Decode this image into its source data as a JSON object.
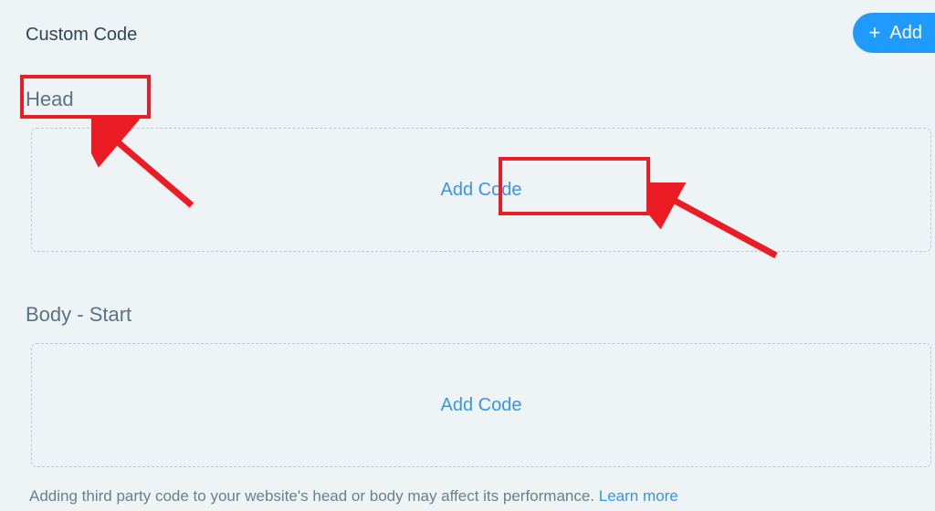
{
  "header": {
    "title": "Custom Code",
    "add_button_label": "Add"
  },
  "sections": {
    "head": {
      "label": "Head",
      "add_code_label": "Add Code"
    },
    "body_start": {
      "label": "Body - Start",
      "add_code_label": "Add Code"
    }
  },
  "footer": {
    "note": "Adding third party code to your website's head or body may affect its performance. ",
    "learn_more_label": "Learn more"
  },
  "annotations": {
    "highlight_head": true,
    "highlight_add_code": true
  },
  "colors": {
    "accent": "#1f9bff",
    "link": "#3a95e6",
    "annotation": "#ec1c24",
    "text": "#2f4457",
    "muted": "#6c7d8b",
    "background": "#eef3f6"
  }
}
